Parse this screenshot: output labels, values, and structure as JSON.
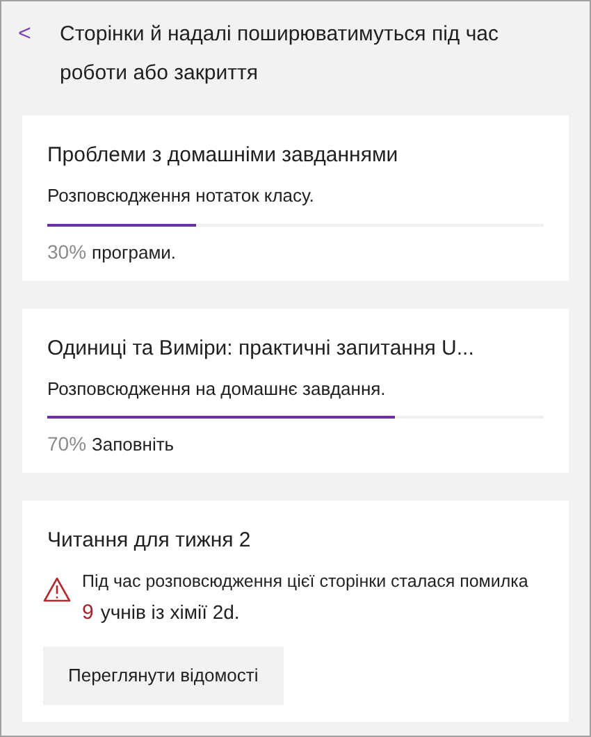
{
  "header": {
    "back": "<",
    "title": "Сторінки й надалі поширюватимуться під час роботи або закриття"
  },
  "cards": [
    {
      "kind": "progress",
      "title": "Проблеми з домашніми завданнями",
      "subtitle": "Розповсюдження нотаток класу.",
      "level": 0.3,
      "percent": "30%",
      "status": "програми."
    },
    {
      "kind": "progress",
      "title": "Одиниці та  Виміри: практичні запитання U...",
      "subtitle": "Розповсюдження на домашнє завдання.",
      "level": 0.7,
      "percent": "70%",
      "status": "Заповніть"
    },
    {
      "kind": "error",
      "title": "Читання для тижня 2",
      "message": "Під час розповсюдження цієї сторінки сталася помилка",
      "count": "9",
      "suffix": "учнів із хімії 2d.",
      "button": "Переглянути відомості"
    }
  ]
}
